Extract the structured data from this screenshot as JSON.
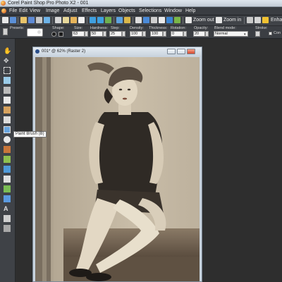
{
  "window": {
    "title": "Corel Paint Shop Pro Photo X2 - 001"
  },
  "menu": [
    "File",
    "Edit",
    "View",
    "Image",
    "Adjust",
    "Effects",
    "Layers",
    "Objects",
    "Selections",
    "Window",
    "Help"
  ],
  "toolbar": {
    "zoom_out": "Zoom out",
    "zoom_in": "Zoom in",
    "enhance": "Enha"
  },
  "options": {
    "presets_label": "Presets:",
    "shape_label": "Shape:",
    "size_label": "Size:",
    "size_value": "63",
    "hardness_label": "Hardness:",
    "hardness_value": "50",
    "step_label": "Step:",
    "step_value": "25",
    "density_label": "Density:",
    "density_value": "100",
    "thickness_label": "Thickness:",
    "thickness_value": "100",
    "rotation_label": "Rotation:",
    "rotation_value": "0",
    "opacity_label": "Opacity:",
    "opacity_value": "20",
    "blend_label": "Blend mode:",
    "blend_value": "Normal",
    "stroke_label": "Stroke:",
    "continuous_label": "Con"
  },
  "document": {
    "title": "001* @ 62% (Raster 2)"
  },
  "tooltip": {
    "text": "Paint Brush (B)"
  },
  "colors": {
    "menu_bg": "#3a3d42",
    "workspace": "#2e2e2e",
    "photo_sepia": "#a89a84"
  }
}
